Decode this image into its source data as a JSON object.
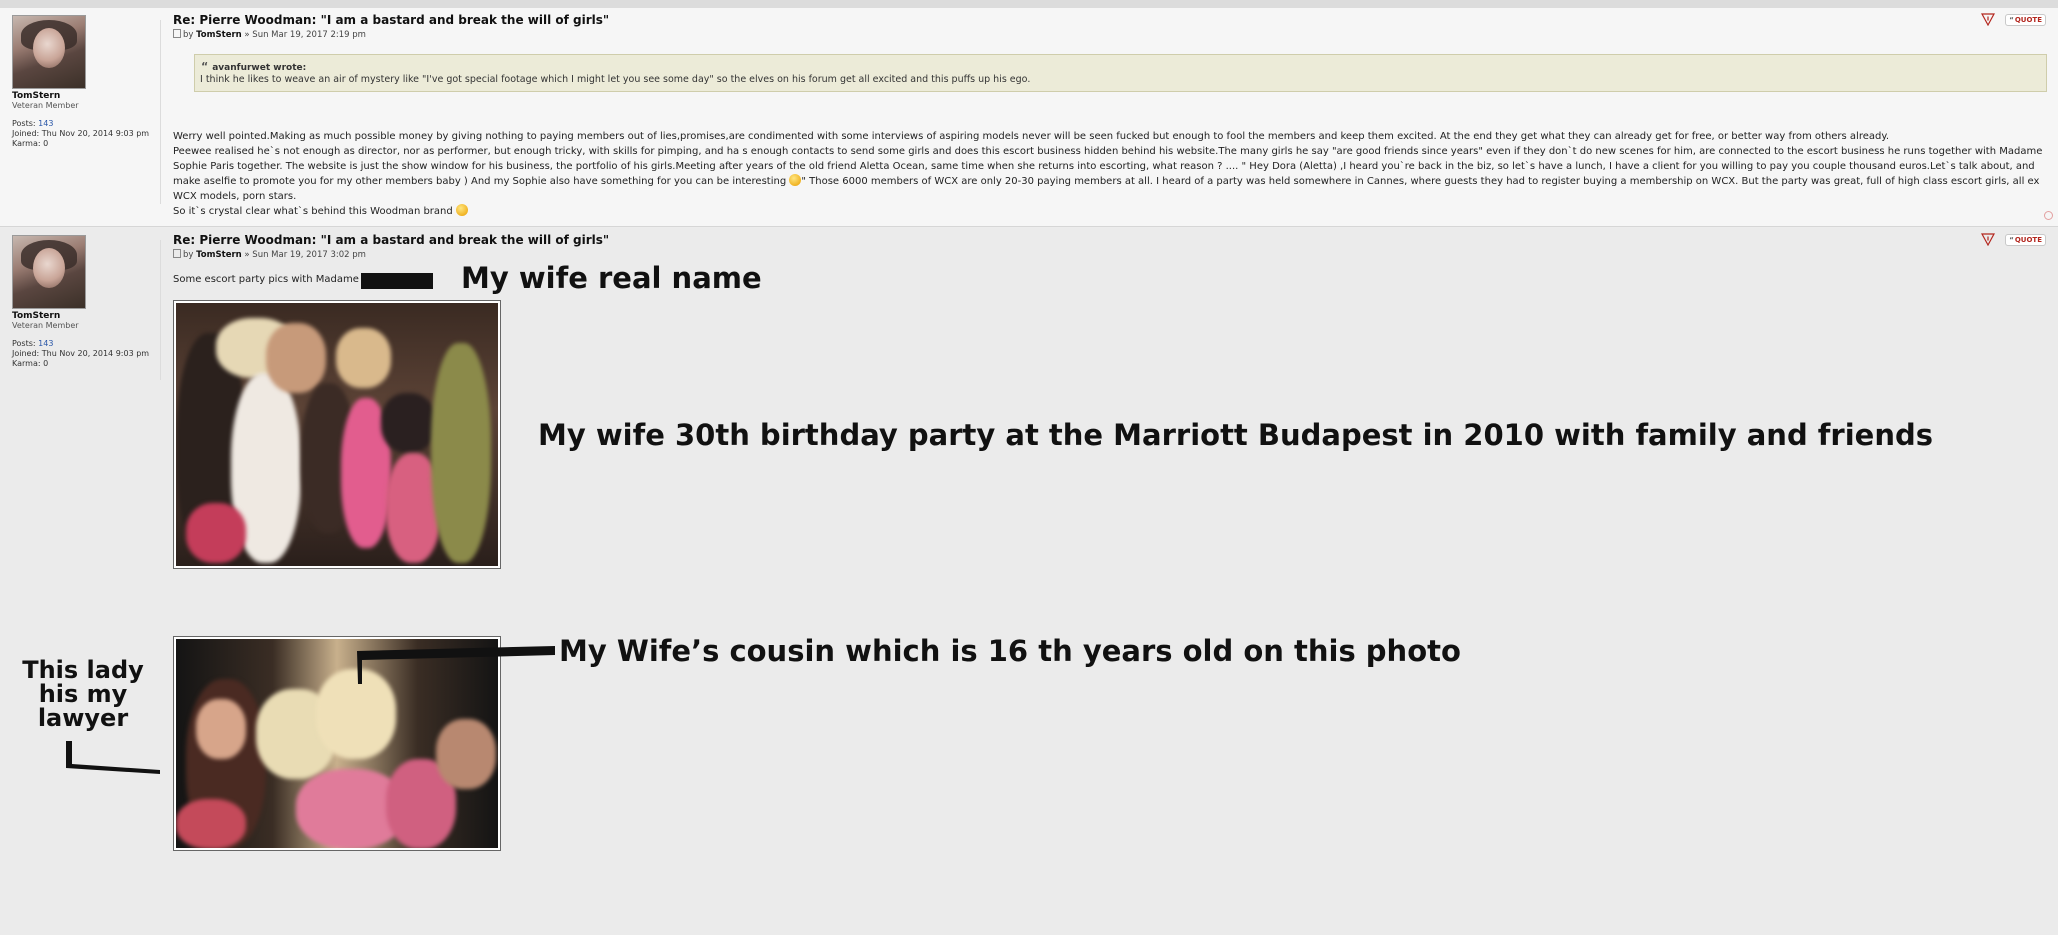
{
  "post1": {
    "author": {
      "username": "TomStern",
      "rank": "Veteran Member",
      "posts_label": "Posts:",
      "posts_value": "143",
      "joined_label": "Joined:",
      "joined_value": "Thu Nov 20, 2014 9:03 pm",
      "karma_label": "Karma:",
      "karma_value": "0"
    },
    "title": "Re: Pierre Woodman: \"I am a bastard and break the will of girls\"",
    "meta_by": "by",
    "meta_author": "TomStern",
    "meta_date": "» Sun Mar 19, 2017 2:19 pm",
    "quote": {
      "cite": "avanfurwet wrote:",
      "text": "I think he likes to weave an air of mystery like \"I've got special footage which I might let you see some day\" so the elves on his forum get all excited and this puffs up his ego."
    },
    "body": {
      "line1": "Werry well pointed.Making as much possible money by giving nothing to paying members out of lies,promises,are condimented with some interviews of aspiring models never will be seen fucked but enough to fool the members and keep them excited. At the end they get what they can already get for free, or better way from others already.",
      "line2a": "Peewee realised he`s not enough as director, nor as performer, but enough tricky, with skills for pimping, and ha s enough contacts to send some girls and does this escort business hidden behind his website.The many girls he say \"are good friends since years\" even if they don`t do new scenes for him, are connected to the escort business he runs together with Madame Sophie Paris together. The website is just the show window for his business, the portfolio of his girls.Meeting after years of the old friend Aletta Ocean, same time when she returns into escorting, what reason ? .... \" Hey Dora (Aletta) ,I heard you`re back in the biz, so let`s have a lunch, I have a client for you willing to pay you couple thousand euros.Let`s talk about, and make aselfie to promote you for my other members baby ) And my Sophie also have something for you can be interesting",
      "line2b": "\" Those 6000 members of WCX are only 20-30 paying members at all. I heard of a party was held somewhere in Cannes, where guests they had to register buying a membership on WCX. But the party was great, full of high class escort girls, all ex WCX models, porn stars.",
      "line3": "So it`s crystal clear what`s behind this Woodman brand"
    },
    "buttons": {
      "quote_label": "QUOTE"
    }
  },
  "post2": {
    "author": {
      "username": "TomStern",
      "rank": "Veteran Member",
      "posts_label": "Posts:",
      "posts_value": "143",
      "joined_label": "Joined:",
      "joined_value": "Thu Nov 20, 2014 9:03 pm",
      "karma_label": "Karma:",
      "karma_value": "0"
    },
    "title": "Re: Pierre Woodman: \"I am a bastard and break the will of girls\"",
    "meta_by": "by",
    "meta_author": "TomStern",
    "meta_date": "» Sun Mar 19, 2017 3:02 pm",
    "body_text": "Some escort party pics with Madame",
    "buttons": {
      "quote_label": "QUOTE"
    }
  },
  "annotations": {
    "wife_name": "My wife real name",
    "birthday": "My wife 30th birthday party at the Marriott Budapest in 2010 with family and friends",
    "cousin": "My Wife’s cousin which is 16 th years old on this photo",
    "lawyer": "This lady his my lawyer"
  }
}
